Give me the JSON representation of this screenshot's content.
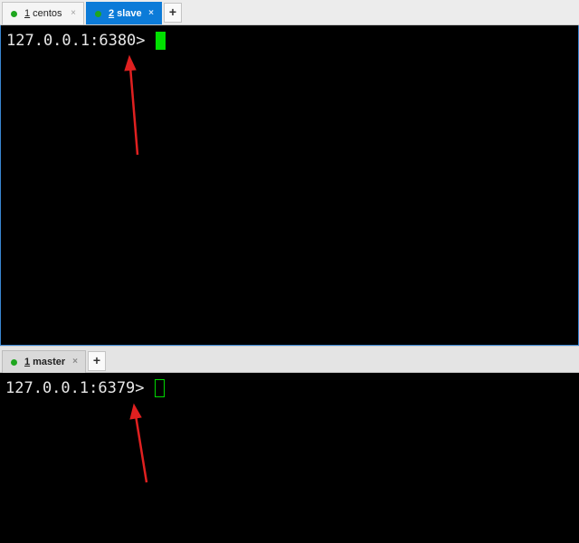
{
  "top_pane": {
    "tabs": [
      {
        "number": "1",
        "label": "centos",
        "active": false
      },
      {
        "number": "2",
        "label": "slave",
        "active": true
      }
    ],
    "add_tab_label": "+",
    "close_glyph": "×",
    "prompt": "127.0.0.1:6380>",
    "cursor_state": "focused"
  },
  "bottom_pane": {
    "tabs": [
      {
        "number": "1",
        "label": "master",
        "active": true
      }
    ],
    "add_tab_label": "+",
    "close_glyph": "×",
    "prompt": "127.0.0.1:6379>",
    "cursor_state": "unfocused"
  },
  "colors": {
    "active_tab": "#0c7bd8",
    "status_dot": "#1fa61f",
    "cursor": "#00e000",
    "annotation_arrow": "#e02020",
    "terminal_bg": "#000000"
  },
  "icons": [
    "close-icon",
    "plus-icon",
    "status-dot-icon"
  ]
}
